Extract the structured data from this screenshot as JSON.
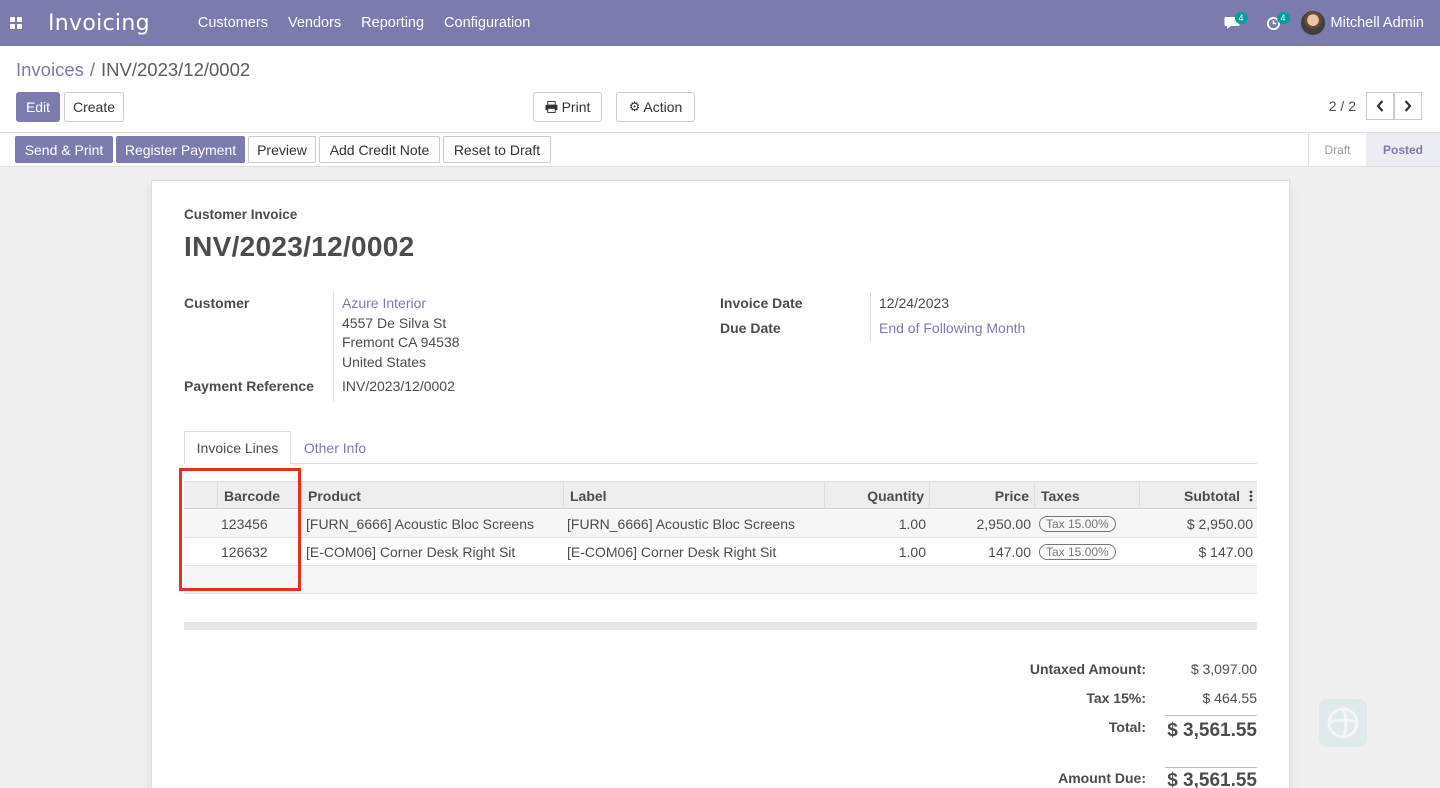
{
  "navbar": {
    "app_title": "Invoicing",
    "menu": [
      "Customers",
      "Vendors",
      "Reporting",
      "Configuration"
    ],
    "messages_badge": "4",
    "activities_badge": "4",
    "user_name": "Mitchell Admin"
  },
  "breadcrumb": {
    "parent": "Invoices",
    "separator": "/",
    "current": "INV/2023/12/0002"
  },
  "buttons": {
    "edit": "Edit",
    "create": "Create",
    "print": "Print",
    "action": "Action"
  },
  "pager": {
    "value": "2 / 2"
  },
  "statusbar": {
    "send_print": "Send & Print",
    "register_payment": "Register Payment",
    "preview": "Preview",
    "add_credit_note": "Add Credit Note",
    "reset_to_draft": "Reset to Draft",
    "steps": [
      "Draft",
      "Posted"
    ],
    "active_step": "Posted"
  },
  "invoice": {
    "type": "Customer Invoice",
    "number": "INV/2023/12/0002",
    "customer_label": "Customer",
    "customer_name": "Azure Interior",
    "address_line1": "4557 De Silva St",
    "address_line2": "Fremont CA 94538",
    "address_line3": "United States",
    "payment_ref_label": "Payment Reference",
    "payment_ref": "INV/2023/12/0002",
    "invoice_date_label": "Invoice Date",
    "invoice_date": "12/24/2023",
    "due_date_label": "Due Date",
    "due_date": "End of Following Month"
  },
  "tabs": [
    "Invoice Lines",
    "Other Info"
  ],
  "table": {
    "columns": [
      "Barcode",
      "Product",
      "Label",
      "Quantity",
      "Price",
      "Taxes",
      "Subtotal"
    ],
    "rows": [
      {
        "barcode": "123456",
        "product": "[FURN_6666] Acoustic Bloc Screens",
        "label": "[FURN_6666] Acoustic Bloc Screens",
        "quantity": "1.00",
        "price": "2,950.00",
        "taxes": "Tax 15.00%",
        "subtotal": "$ 2,950.00"
      },
      {
        "barcode": "126632",
        "product": "[E-COM06] Corner Desk Right Sit",
        "label": "[E-COM06] Corner Desk Right Sit",
        "quantity": "1.00",
        "price": "147.00",
        "taxes": "Tax 15.00%",
        "subtotal": "$ 147.00"
      }
    ]
  },
  "totals": {
    "untaxed_label": "Untaxed Amount:",
    "untaxed": "$ 3,097.00",
    "tax_label": "Tax 15%:",
    "tax": "$ 464.55",
    "total_label": "Total:",
    "total": "$ 3,561.55",
    "amount_due_label": "Amount Due:",
    "amount_due": "$ 3,561.55"
  },
  "colors": {
    "brand": "#7c7bad",
    "highlight": "#e8301c"
  },
  "icons": [
    "apps-grid-icon",
    "chat-icon",
    "activity-clock-icon",
    "print-icon",
    "gear-icon",
    "chevron-left-icon",
    "chevron-right-icon",
    "column-options-icon"
  ]
}
